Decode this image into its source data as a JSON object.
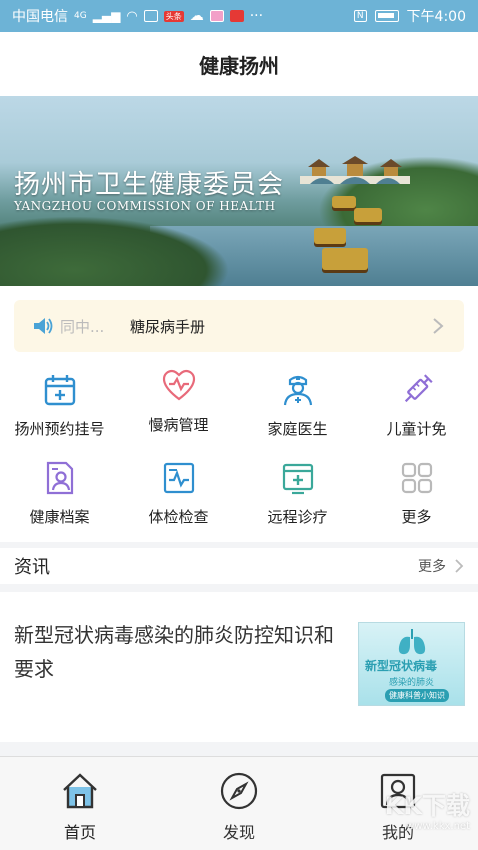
{
  "statusbar": {
    "carrier": "中国电信",
    "network": "4G",
    "time": "下午4:00",
    "badge_app": "头条"
  },
  "header": {
    "title": "健康扬州"
  },
  "banner": {
    "title_cn": "扬州市卫生健康委员会",
    "title_en": "YANGZHOU COMMISSION OF HEALTH"
  },
  "notice": {
    "prefix": "同中...",
    "text": "糖尿病手册",
    "icon": "speaker-icon"
  },
  "services": {
    "items": [
      {
        "label": "扬州预约挂号",
        "icon": "calendar-plus-icon",
        "color": "#2f8fcf"
      },
      {
        "label": "慢病管理",
        "icon": "heart-pulse-icon",
        "color": "#e86a7a"
      },
      {
        "label": "家庭医生",
        "icon": "doctor-icon",
        "color": "#2f8fcf"
      },
      {
        "label": "儿童计免",
        "icon": "syringe-icon",
        "color": "#8f6fd6"
      },
      {
        "label": "健康档案",
        "icon": "profile-doc-icon",
        "color": "#8f6fd6"
      },
      {
        "label": "体检检查",
        "icon": "ecg-report-icon",
        "color": "#2f8fcf"
      },
      {
        "label": "远程诊疗",
        "icon": "telemedicine-icon",
        "color": "#3aa89a"
      },
      {
        "label": "更多",
        "icon": "grid-more-icon",
        "color": "#b9b9b9"
      }
    ]
  },
  "news": {
    "section_title": "资讯",
    "more_label": "更多",
    "article_title": "新型冠状病毒感染的肺炎防控知识和要求",
    "thumb_title": "新型冠状病毒",
    "thumb_subtitle": "感染的肺炎",
    "thumb_badge": "健康科普小知识"
  },
  "tabbar": {
    "tabs": [
      {
        "label": "首页",
        "icon": "home-icon",
        "active": true
      },
      {
        "label": "发现",
        "icon": "compass-icon",
        "active": false
      },
      {
        "label": "我的",
        "icon": "user-icon",
        "active": false
      }
    ]
  },
  "watermark": {
    "text": "KK下载",
    "url": "www.kkx.net"
  },
  "colors": {
    "accent": "#2f8fcf",
    "statusbar": "#6db3d6",
    "notice_bg": "#fdf7e6"
  }
}
